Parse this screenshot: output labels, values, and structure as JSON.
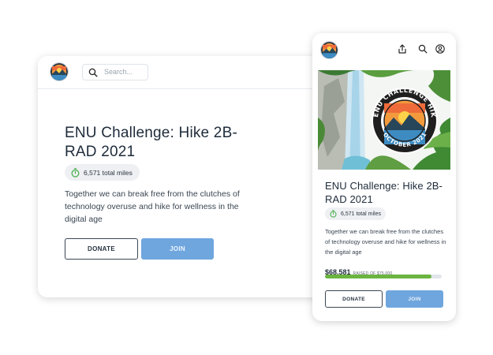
{
  "desktop": {
    "search": {
      "placeholder": "Search..."
    },
    "title": "ENU Challenge: Hike 2B-RAD 2021",
    "miles": "6,571 total miles",
    "description": "Together we can break free from the clutches of technology overuse and hike for wellness in the digital age",
    "donate_label": "DONATE",
    "join_label": "JOIN"
  },
  "mobile": {
    "icons": [
      "share-icon",
      "search-icon",
      "user-icon"
    ],
    "hero_badge": {
      "line1": "ENU CHALLENGE",
      "line2": "HIKE 2B-RAD",
      "line3": "OCTOBER 2021"
    },
    "title": "ENU Challenge: Hike 2B-RAD 2021",
    "miles": "6,571 total miles",
    "description": "Together we can break free from the clutches of technology overuse and hike for wellness in the digital age",
    "raised_amount": "$68,581",
    "raised_goal": "RAISED OF $75,000",
    "progress_fraction": 0.914,
    "donate_label": "DONATE",
    "join_label": "JOIN"
  },
  "colors": {
    "accent_blue": "#6fa6de",
    "progress_green": "#6bb43f",
    "timer_green": "#4caf50",
    "text_dark": "#1e2b3a"
  }
}
